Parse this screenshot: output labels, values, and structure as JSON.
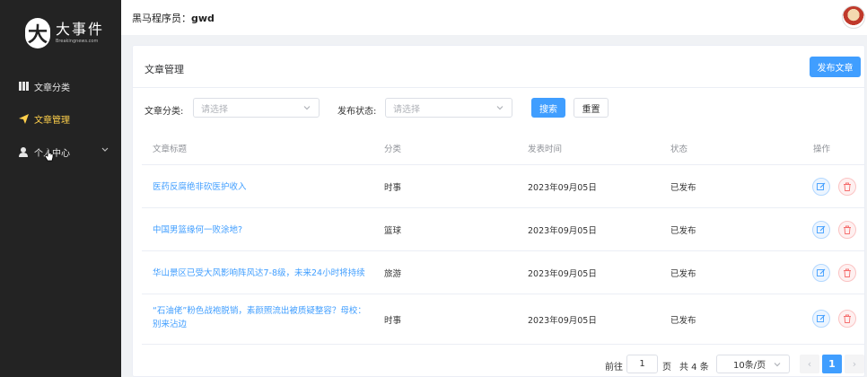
{
  "logo": {
    "mark": "大",
    "title": "大事件",
    "subtitle": "Breakingnews.com"
  },
  "sidebar": {
    "items": [
      {
        "label": "文章分类",
        "icon": "grid-icon",
        "active": false
      },
      {
        "label": "文章管理",
        "icon": "send-icon",
        "active": true
      },
      {
        "label": "个人中心",
        "icon": "user-icon",
        "active": false,
        "expandable": true
      }
    ]
  },
  "header": {
    "user_prefix": "黑马程序员：",
    "user_name": "gwd"
  },
  "card": {
    "title": "文章管理",
    "publish_button": "发布文章"
  },
  "filters": {
    "category_label": "文章分类:",
    "category_placeholder": "请选择",
    "state_label": "发布状态:",
    "state_placeholder": "请选择",
    "search_button": "搜索",
    "reset_button": "重置"
  },
  "table": {
    "columns": [
      "文章标题",
      "分类",
      "发表时间",
      "状态",
      "操作"
    ],
    "rows": [
      {
        "title": "医药反腐绝非砍医护收入",
        "category": "时事",
        "date": "2023年09月05日",
        "state": "已发布"
      },
      {
        "title": "中国男篮缘何一败涂地?",
        "category": "篮球",
        "date": "2023年09月05日",
        "state": "已发布"
      },
      {
        "title": "华山景区已受大风影响阵风达7-8级，未来24小时将持续",
        "category": "旅游",
        "date": "2023年09月05日",
        "state": "已发布"
      },
      {
        "title": "“石油佬”粉色战袍脱销，素颜照流出被质疑整容？母校：别来沾边",
        "category": "时事",
        "date": "2023年09月05日",
        "state": "已发布"
      }
    ]
  },
  "pagination": {
    "goto_label": "前往",
    "goto_value": "1",
    "page_suffix": "页",
    "total": "共 4 条",
    "page_size": "10条/页",
    "current_page": "1",
    "prev": "‹",
    "next": "›"
  },
  "colors": {
    "primary": "#409eff",
    "sidebar_bg": "#232323",
    "active_menu": "#ffd04b",
    "danger": "#f56c6c"
  }
}
